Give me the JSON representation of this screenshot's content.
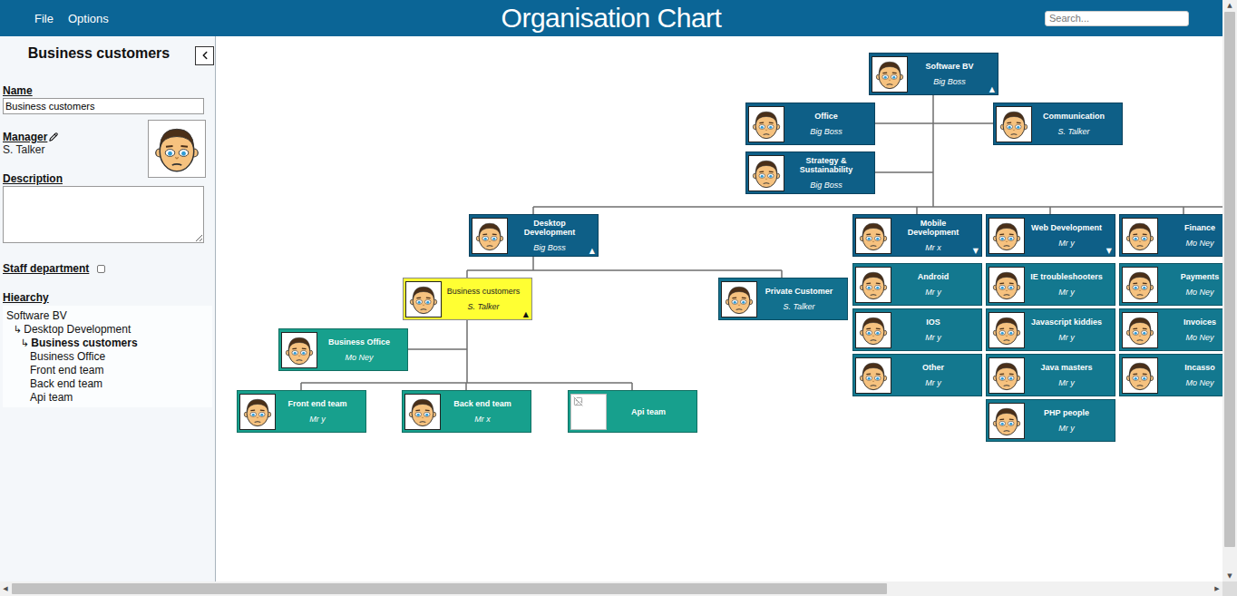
{
  "menu": [
    "File",
    "Options"
  ],
  "title": "Organisation Chart",
  "search": {
    "placeholder": "Search...",
    "value": ""
  },
  "sidebar": {
    "heading": "Business customers",
    "name": {
      "label": "Name",
      "value": "Business customers"
    },
    "manager": {
      "label": "Manager",
      "value": "S. Talker"
    },
    "description": {
      "label": "Description",
      "value": ""
    },
    "staff_department": {
      "label": "Staff department",
      "checked": false
    },
    "hierarchy": {
      "label": "Hiearchy",
      "items": [
        {
          "label": "Software BV",
          "prefix": "",
          "depth": 0,
          "selected": false
        },
        {
          "label": "Desktop Development",
          "prefix": "↳",
          "depth": 1,
          "selected": false
        },
        {
          "label": "Business customers",
          "prefix": "↳",
          "depth": 2,
          "selected": true
        },
        {
          "label": "Business Office",
          "prefix": "",
          "depth": 3,
          "selected": false
        },
        {
          "label": "Front end team",
          "prefix": "",
          "depth": 3,
          "selected": false
        },
        {
          "label": "Back end team",
          "prefix": "",
          "depth": 3,
          "selected": false
        },
        {
          "label": "Api team",
          "prefix": "",
          "depth": 3,
          "selected": false
        }
      ]
    }
  },
  "chart": {
    "nodes": [
      {
        "name": "Software BV",
        "title": "Big Boss",
        "color": "#0e5f87",
        "selected": false,
        "toggle": "▲",
        "photo": true
      },
      {
        "name": "Office",
        "title": "Big Boss",
        "color": "#0e5f87",
        "selected": false,
        "toggle": "",
        "photo": true
      },
      {
        "name": "Communication",
        "title": "S. Talker",
        "color": "#0e5f87",
        "selected": false,
        "toggle": "",
        "photo": true
      },
      {
        "name": "Strategy & Sustainability",
        "title": "Big Boss",
        "color": "#0e5f87",
        "selected": false,
        "toggle": "",
        "photo": true
      },
      {
        "name": "Desktop Development",
        "title": "Big Boss",
        "color": "#0e5f87",
        "selected": false,
        "toggle": "▲",
        "photo": true
      },
      {
        "name": "Mobile Development",
        "title": "Mr x",
        "color": "#0e5f87",
        "selected": false,
        "toggle": "▼",
        "photo": true
      },
      {
        "name": "Web Development",
        "title": "Mr y",
        "color": "#0e5f87",
        "selected": false,
        "toggle": "▼",
        "photo": true
      },
      {
        "name": "Finance",
        "title": "Mo Ney",
        "color": "#0e5f87",
        "selected": false,
        "toggle": "",
        "photo": true
      },
      {
        "name": "Business customers",
        "title": "S. Talker",
        "color": "#ffff33",
        "selected": true,
        "toggle": "▲",
        "photo": true
      },
      {
        "name": "Private Customer",
        "title": "S. Talker",
        "color": "#12708e",
        "selected": false,
        "toggle": "",
        "photo": true
      },
      {
        "name": "Android",
        "title": "Mr y",
        "color": "#13788f",
        "selected": false,
        "toggle": "",
        "photo": true
      },
      {
        "name": "IOS",
        "title": "Mr y",
        "color": "#13788f",
        "selected": false,
        "toggle": "",
        "photo": true
      },
      {
        "name": "Other",
        "title": "Mr y",
        "color": "#13788f",
        "selected": false,
        "toggle": "",
        "photo": true
      },
      {
        "name": "IE troubleshooters",
        "title": "Mr y",
        "color": "#13788f",
        "selected": false,
        "toggle": "",
        "photo": true
      },
      {
        "name": "Javascript kiddies",
        "title": "Mr y",
        "color": "#13788f",
        "selected": false,
        "toggle": "",
        "photo": true
      },
      {
        "name": "Java masters",
        "title": "Mr y",
        "color": "#13788f",
        "selected": false,
        "toggle": "",
        "photo": true
      },
      {
        "name": "PHP people",
        "title": "Mr y",
        "color": "#13788f",
        "selected": false,
        "toggle": "",
        "photo": true
      },
      {
        "name": "Payments",
        "title": "Mo Ney",
        "color": "#13788f",
        "selected": false,
        "toggle": "",
        "photo": true
      },
      {
        "name": "Invoices",
        "title": "Mo Ney",
        "color": "#13788f",
        "selected": false,
        "toggle": "",
        "photo": true
      },
      {
        "name": "Incasso",
        "title": "Mo Ney",
        "color": "#13788f",
        "selected": false,
        "toggle": "",
        "photo": true
      },
      {
        "name": "Business Office",
        "title": "Mo Ney",
        "color": "#17a08d",
        "selected": false,
        "toggle": "",
        "photo": true
      },
      {
        "name": "Front end team",
        "title": "Mr y",
        "color": "#17a08d",
        "selected": false,
        "toggle": "",
        "photo": true
      },
      {
        "name": "Back end team",
        "title": "Mr x",
        "color": "#17a08d",
        "selected": false,
        "toggle": "",
        "photo": true
      },
      {
        "name": "Api team",
        "title": "",
        "color": "#17a08d",
        "selected": false,
        "toggle": "",
        "photo": false
      }
    ]
  },
  "scrollbars": {
    "vertical": {
      "level": 0.96,
      "arrows": [
        "▲",
        "▼"
      ]
    },
    "horizontal": {
      "level": 0.73,
      "arrows": [
        "◀",
        "▶"
      ]
    }
  }
}
